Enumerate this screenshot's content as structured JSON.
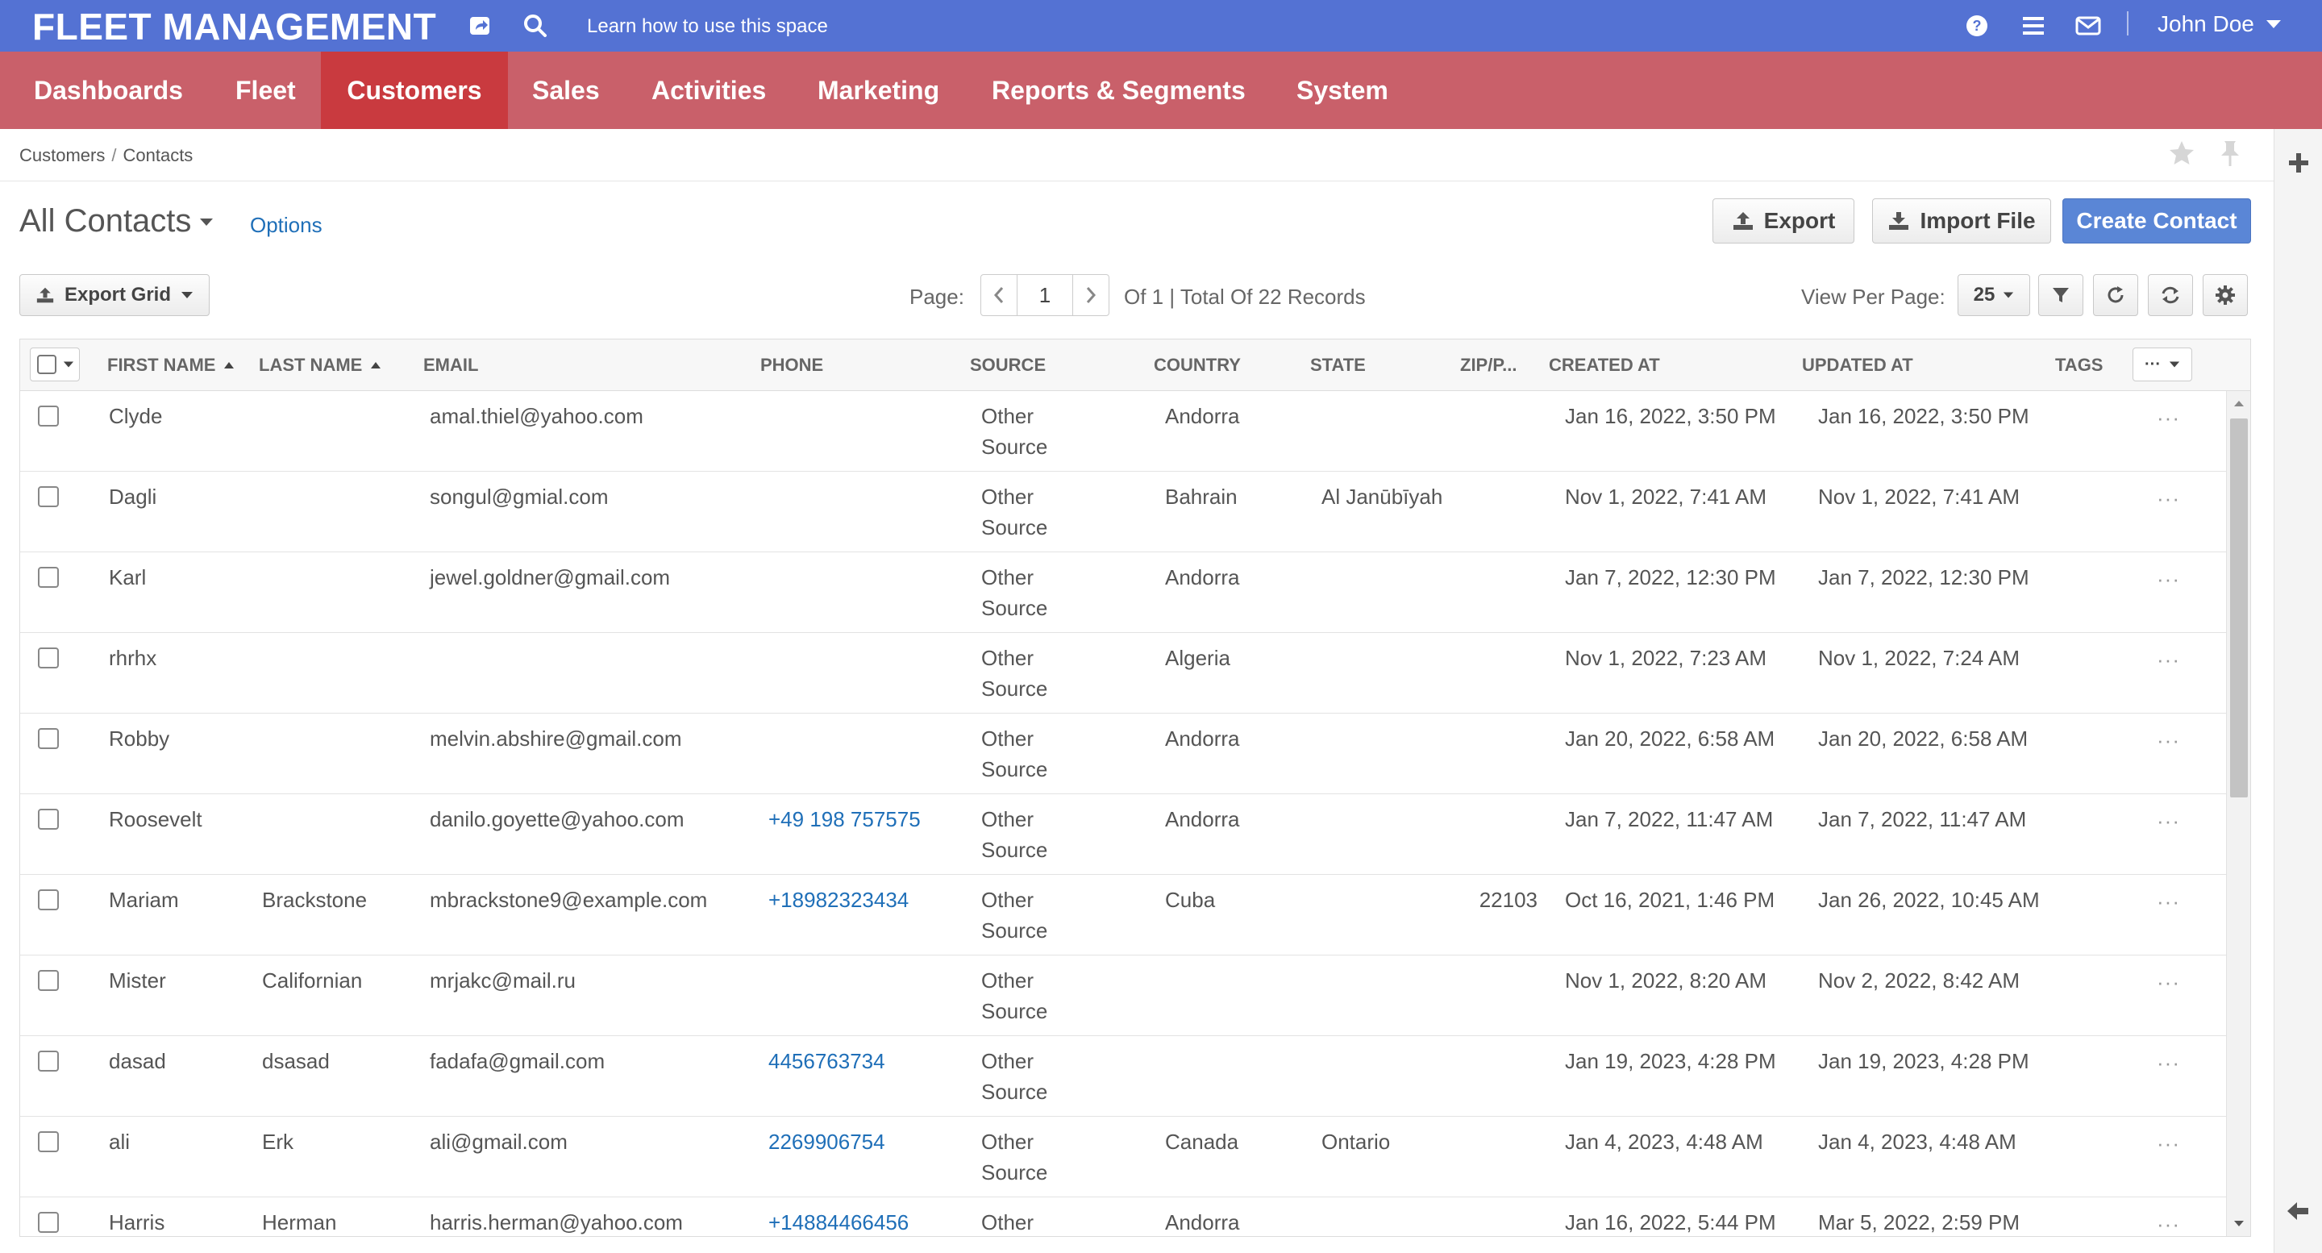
{
  "app": {
    "brand": "FLEET MANAGEMENT",
    "learn_link": "Learn how to use this space",
    "user_name": "John Doe",
    "icons": [
      "share-icon",
      "search-icon",
      "help-icon",
      "list-icon",
      "mail-icon",
      "caret-down-icon"
    ]
  },
  "menu": {
    "items": [
      "Dashboards",
      "Fleet",
      "Customers",
      "Sales",
      "Activities",
      "Marketing",
      "Reports & Segments",
      "System"
    ],
    "active": "Customers"
  },
  "breadcrumb": {
    "parent": "Customers",
    "current": "Contacts",
    "separator": "/"
  },
  "page": {
    "title": "All Contacts",
    "options": "Options",
    "export_label": "Export",
    "import_label": "Import File",
    "create_label": "Create Contact"
  },
  "toolbar": {
    "export_grid": "Export Grid",
    "page_label": "Page:",
    "current_page": "1",
    "page_summary": "Of 1 | Total Of 22 Records",
    "view_per_page_label": "View Per Page:",
    "per_page": "25"
  },
  "grid": {
    "columns": [
      "FIRST NAME",
      "LAST NAME",
      "EMAIL",
      "PHONE",
      "SOURCE",
      "COUNTRY",
      "STATE",
      "ZIP/P...",
      "CREATED AT",
      "UPDATED AT",
      "TAGS"
    ],
    "rows": [
      {
        "first": "Clyde",
        "last": "",
        "email": "amal.thiel@yahoo.com",
        "phone": "",
        "source": "Other Source",
        "country": "Andorra",
        "state": "",
        "zip": "",
        "created": "Jan 16, 2022, 3:50 PM",
        "updated": "Jan 16, 2022, 3:50 PM"
      },
      {
        "first": "Dagli",
        "last": "",
        "email": "songul@gmial.com",
        "phone": "",
        "source": "Other Source",
        "country": "Bahrain",
        "state": "Al Janūbīyah",
        "zip": "",
        "created": "Nov 1, 2022, 7:41 AM",
        "updated": "Nov 1, 2022, 7:41 AM"
      },
      {
        "first": "Karl",
        "last": "",
        "email": "jewel.goldner@gmail.com",
        "phone": "",
        "source": "Other Source",
        "country": "Andorra",
        "state": "",
        "zip": "",
        "created": "Jan 7, 2022, 12:30 PM",
        "updated": "Jan 7, 2022, 12:30 PM"
      },
      {
        "first": "rhrhx",
        "last": "",
        "email": "",
        "phone": "",
        "source": "Other Source",
        "country": "Algeria",
        "state": "",
        "zip": "",
        "created": "Nov 1, 2022, 7:23 AM",
        "updated": "Nov 1, 2022, 7:24 AM"
      },
      {
        "first": "Robby",
        "last": "",
        "email": "melvin.abshire@gmail.com",
        "phone": "",
        "source": "Other Source",
        "country": "Andorra",
        "state": "",
        "zip": "",
        "created": "Jan 20, 2022, 6:58 AM",
        "updated": "Jan 20, 2022, 6:58 AM"
      },
      {
        "first": "Roosevelt",
        "last": "",
        "email": "danilo.goyette@yahoo.com",
        "phone": "+49 198 757575",
        "source": "Other Source",
        "country": "Andorra",
        "state": "",
        "zip": "",
        "created": "Jan 7, 2022, 11:47 AM",
        "updated": "Jan 7, 2022, 11:47 AM"
      },
      {
        "first": "Mariam",
        "last": "Brackstone",
        "email": "mbrackstone9@example.com",
        "phone": "+18982323434",
        "source": "Other Source",
        "country": "Cuba",
        "state": "",
        "zip": "22103",
        "created": "Oct 16, 2021, 1:46 PM",
        "updated": "Jan 26, 2022, 10:45 AM"
      },
      {
        "first": "Mister",
        "last": "Californian",
        "email": "mrjakc@mail.ru",
        "phone": "",
        "source": "Other Source",
        "country": "",
        "state": "",
        "zip": "",
        "created": "Nov 1, 2022, 8:20 AM",
        "updated": "Nov 2, 2022, 8:42 AM"
      },
      {
        "first": "dasad",
        "last": "dsasad",
        "email": "fadafa@gmail.com",
        "phone": "4456763734",
        "source": "Other Source",
        "country": "",
        "state": "",
        "zip": "",
        "created": "Jan 19, 2023, 4:28 PM",
        "updated": "Jan 19, 2023, 4:28 PM"
      },
      {
        "first": "ali",
        "last": "Erk",
        "email": "ali@gmail.com",
        "phone": "2269906754",
        "source": "Other Source",
        "country": "Canada",
        "state": "Ontario",
        "zip": "",
        "created": "Jan 4, 2023, 4:48 AM",
        "updated": "Jan 4, 2023, 4:48 AM"
      },
      {
        "first": "Harris",
        "last": "Herman",
        "email": "harris.herman@yahoo.com",
        "phone": "+14884466456",
        "source": "Other",
        "country": "Andorra",
        "state": "",
        "zip": "",
        "created": "Jan 16, 2022, 5:44 PM",
        "updated": "Mar 5, 2022, 2:59 PM"
      }
    ],
    "row_action": "···"
  },
  "colors": {
    "topbar": "#5472d3",
    "menu": "#c9606a",
    "menu_active": "#c93a3f",
    "primary_button": "#5a86d6",
    "link": "#1f6fb8"
  }
}
